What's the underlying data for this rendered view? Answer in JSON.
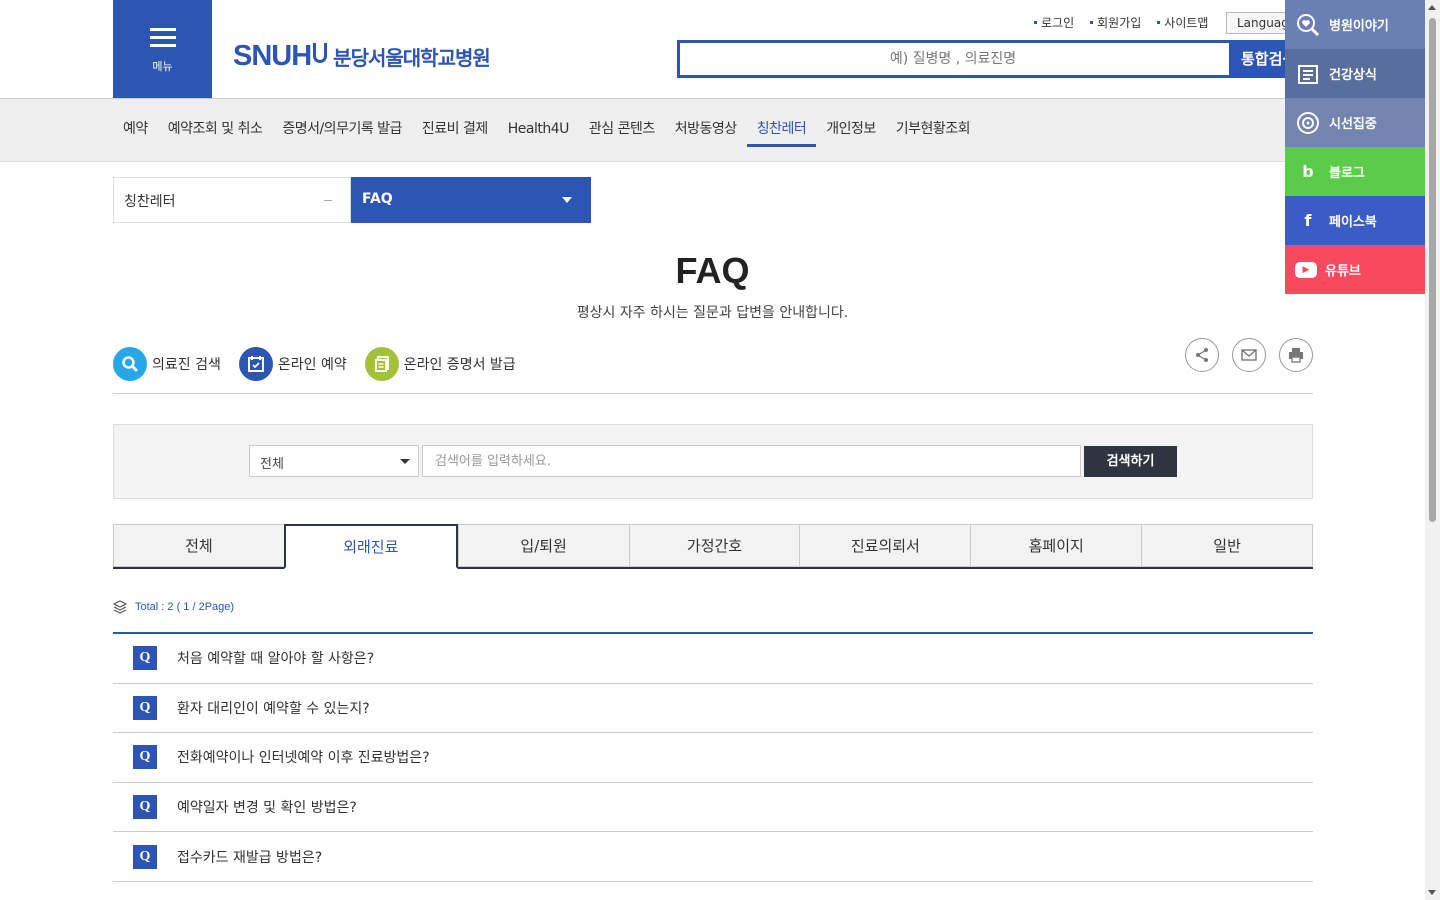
{
  "header": {
    "menu_label": "메뉴",
    "logo_text": "SNUH",
    "hospital_name": "분당서울대학교병원",
    "util_links": [
      "로그인",
      "회원가입",
      "사이트맵"
    ],
    "language_label": "Language",
    "search_placeholder": "예) 질병명 , 의료진명",
    "search_button": "통합검색"
  },
  "gnb": {
    "items": [
      "예약",
      "예약조회 및 취소",
      "증명서/의무기록 발급",
      "진료비 결제",
      "Health4U",
      "관심 콘텐츠",
      "처방동영상",
      "칭찬레터",
      "개인정보",
      "기부현황조회"
    ],
    "active": "칭찬레터"
  },
  "quick_menu": [
    {
      "label": "병원이야기",
      "icon": "heart-search-icon"
    },
    {
      "label": "건강상식",
      "icon": "list-icon"
    },
    {
      "label": "시선집중",
      "icon": "target-icon"
    },
    {
      "label": "블로그",
      "icon": "blog-icon"
    },
    {
      "label": "페이스북",
      "icon": "facebook-icon"
    },
    {
      "label": "유튜브",
      "icon": "youtube-icon"
    }
  ],
  "location": {
    "first": "칭찬레터",
    "second": "FAQ"
  },
  "page": {
    "title": "FAQ",
    "description": "평상시 자주 하시는 질문과 답변을 안내합니다."
  },
  "shortcuts": [
    "의료진 검색",
    "온라인 예약",
    "온라인 증명서 발급"
  ],
  "search": {
    "select_value": "전체",
    "placeholder": "검색어를 입력하세요.",
    "button": "검색하기"
  },
  "tabs": [
    "전체",
    "외래진료",
    "입/퇴원",
    "가정간호",
    "진료의뢰서",
    "홈페이지",
    "일반"
  ],
  "active_tab": "외래진료",
  "total": "Total : 2 ( 1 / 2Page)",
  "faq_items": [
    "처음 예약할 때 알아야 할 사항은?",
    "환자 대리인이 예약할 수 있는지?",
    "전화예약이나 인터넷예약 이후 진료방법은?",
    "예약일자 변경 및 확인 방법은?",
    "접수카드 재발급 방법은?"
  ],
  "q_mark": "Q",
  "colors": {
    "primary": "#2d55b4",
    "dark": "#2e3540",
    "blog": "#5bcb49",
    "youtube": "#f8495e"
  }
}
